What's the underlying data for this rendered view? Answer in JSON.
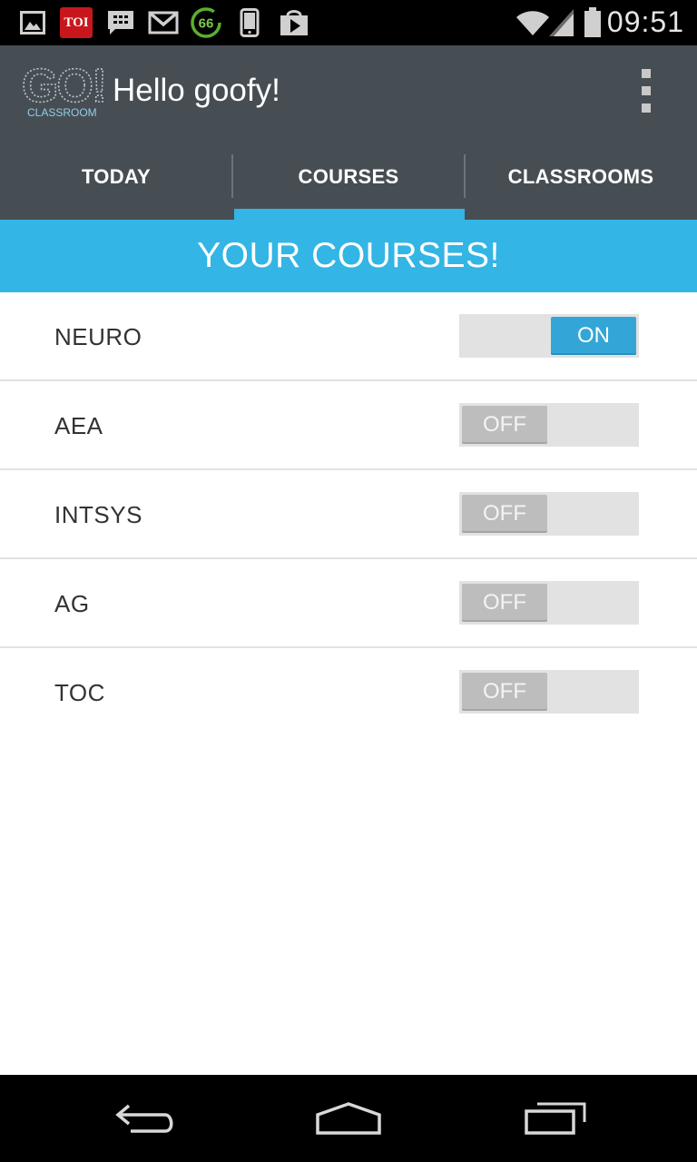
{
  "status_bar": {
    "time": "09:51",
    "notification_icons": [
      "image-icon",
      "toi-app-icon",
      "bbm-icon",
      "gmail-icon",
      "battery-widget-icon",
      "phone-device-icon",
      "play-store-icon"
    ],
    "toi_label": "TOI",
    "widget_count": "66",
    "system_icons": [
      "wifi-icon",
      "signal-icon",
      "battery-icon"
    ]
  },
  "action_bar": {
    "logo_text": "GO!",
    "logo_subtext": "CLASSROOM",
    "title": "Hello goofy!",
    "overflow_icon": "overflow-menu-icon"
  },
  "tabs": [
    {
      "label": "TODAY",
      "active": false
    },
    {
      "label": "COURSES",
      "active": true
    },
    {
      "label": "CLASSROOMS",
      "active": false
    }
  ],
  "header": {
    "title": "YOUR COURSES!"
  },
  "courses": [
    {
      "name": "NEURO",
      "state": "ON"
    },
    {
      "name": "AEA",
      "state": "OFF"
    },
    {
      "name": "INTSYS",
      "state": "OFF"
    },
    {
      "name": "AG",
      "state": "OFF"
    },
    {
      "name": "TOC",
      "state": "OFF"
    }
  ],
  "nav_bar": {
    "icons": [
      "back-icon",
      "home-icon",
      "recent-apps-icon"
    ]
  },
  "colors": {
    "accent": "#33b5e5",
    "action_bar": "#474e53",
    "switch_on": "#33a6d7",
    "switch_off": "#bdbdbd"
  }
}
